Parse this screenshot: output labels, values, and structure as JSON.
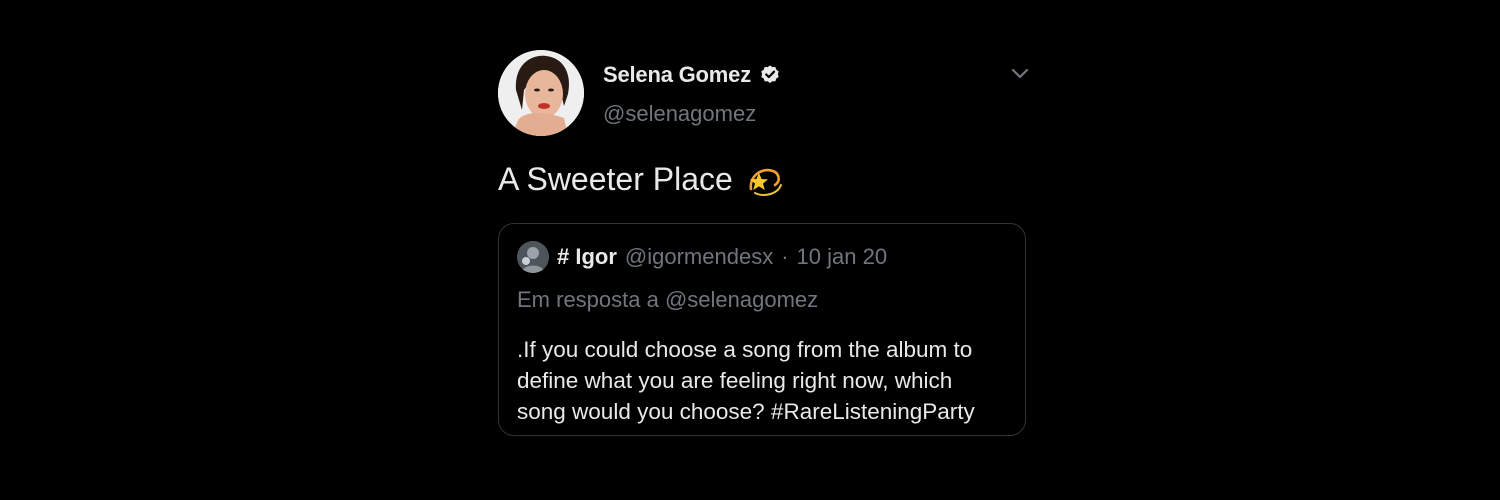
{
  "tweet": {
    "author": {
      "display_name": "Selena Gomez",
      "handle": "@selenagomez",
      "verified": true
    },
    "text": "A Sweeter Place",
    "emoji": "dizzy-star-icon",
    "more_icon": "chevron-down-icon",
    "quoted": {
      "author_name": "# Igor",
      "author_handle": "@igormendesx",
      "separator": "·",
      "date": "10 jan 20",
      "reply_to": "Em resposta a @selenagomez",
      "text_lines": [
        ".If you could choose a song from the album to",
        "define what you are feeling right now, which",
        "song would you choose? #RareListeningParty"
      ]
    }
  },
  "colors": {
    "background": "#000000",
    "primary_text": "#e7e9ea",
    "secondary_text": "#71767b",
    "border": "#2f3336"
  }
}
